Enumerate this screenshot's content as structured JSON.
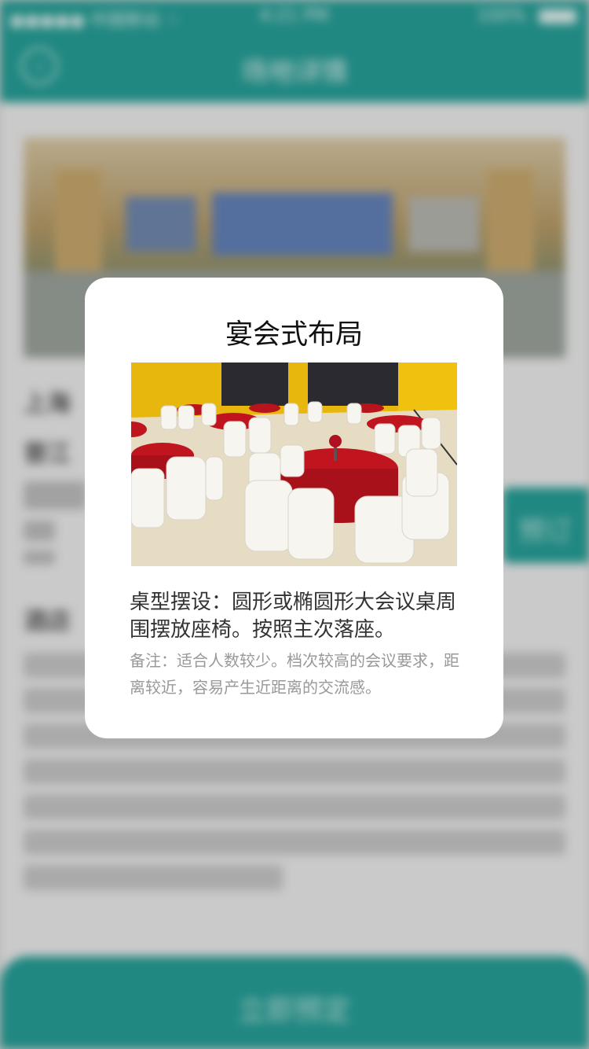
{
  "status_bar": {
    "carrier": "●●●●● 中国移动 ⌔",
    "time": "4:21 PM",
    "battery": "100%"
  },
  "nav": {
    "title": "场地详情",
    "back_glyph": "‹"
  },
  "background": {
    "venue_name": "上海",
    "subtitle": "晋江",
    "book_button": "预订",
    "section_title": "酒店",
    "bottom_button": "立即预定"
  },
  "modal": {
    "title": "宴会式布局",
    "description": "桌型摆设：圆形或椭圆形大会议桌周围摆放座椅。按照主次落座。",
    "note": "备注：适合人数较少。档次较高的会议要求，距离较近，容易产生近距离的交流感。"
  },
  "colors": {
    "primary": "#1f9d95",
    "tablecloth": "#c0141e",
    "wall": "#e9b90c"
  }
}
